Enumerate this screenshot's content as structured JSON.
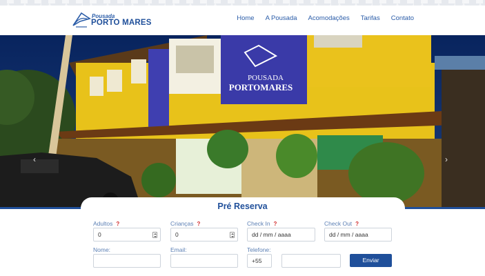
{
  "brand": {
    "small": "Pousada",
    "big": "PORTO MARES"
  },
  "nav": [
    "Home",
    "A Pousada",
    "Acomodações",
    "Tarifas",
    "Contato"
  ],
  "hero": {
    "sign_line1": "POUSADA",
    "sign_line2": "PORTOMARES",
    "prev_arrow": "‹",
    "next_arrow": "›"
  },
  "form": {
    "title": "Pré Reserva",
    "help_mark": "?",
    "adults": {
      "label": "Adultos",
      "value": "0"
    },
    "children": {
      "label": "Crianças",
      "value": "0"
    },
    "checkin": {
      "label": "Check In",
      "placeholder": "dd / mm / aaaa"
    },
    "checkout": {
      "label": "Check Out",
      "placeholder": "dd / mm / aaaa"
    },
    "name": {
      "label": "Nome:",
      "value": ""
    },
    "email": {
      "label": "Email:",
      "value": ""
    },
    "phone": {
      "label": "Telefone:",
      "prefix": "+55",
      "value": ""
    },
    "submit": "Enviar"
  },
  "colors": {
    "primary": "#1f4f9a",
    "label": "#5b7fb4",
    "help": "#d12a2a"
  }
}
